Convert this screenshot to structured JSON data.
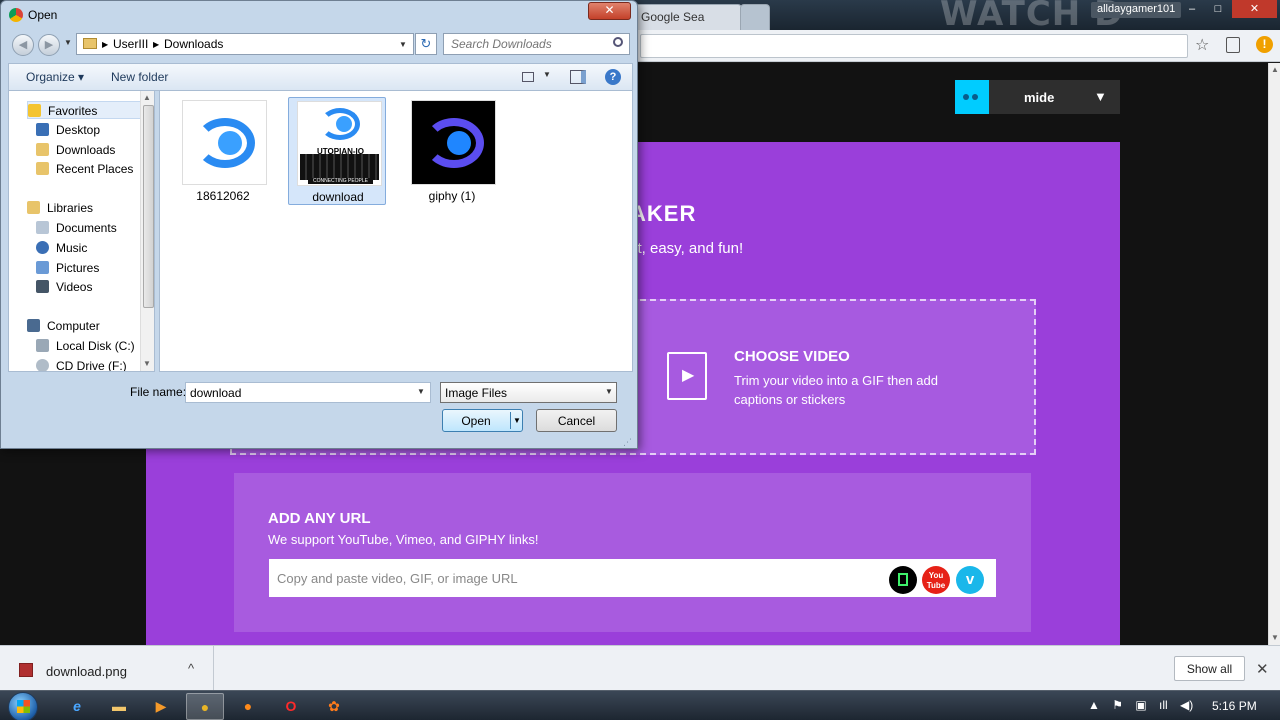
{
  "browser": {
    "tabs": [
      {
        "label": "Google Sea"
      },
      {
        "label": ""
      }
    ],
    "watermark_text": "WATCH D",
    "profile_name": "alldaygamer101",
    "window_controls": {
      "minimize": "–",
      "maximize": "□",
      "close": "✕"
    },
    "toolbar_icons": [
      "star-icon",
      "page-icon",
      "alert-icon"
    ],
    "alert_glyph": "!"
  },
  "site": {
    "user_menu": {
      "name": "mide",
      "caret": "▼"
    },
    "maker_title": "AKER",
    "maker_subtitle": "st, easy, and fun!",
    "choose_video": {
      "title": "CHOOSE VIDEO",
      "description": "Trim your video into a GIF then add captions or stickers",
      "play_glyph": "▶"
    },
    "add_url": {
      "title": "ADD ANY URL",
      "subtitle": "We support YouTube, Vimeo, and GIPHY links!",
      "placeholder": "Copy and paste video, GIF, or image URL",
      "source_icons": [
        "giphy-icon",
        "youtube-icon",
        "vimeo-icon"
      ],
      "youtube_text": "You Tube",
      "vimeo_glyph": "v"
    },
    "colors": {
      "panel": "#9a3fda",
      "accent": "#00ccff"
    }
  },
  "download_bar": {
    "file_name": "download.png",
    "caret": "^",
    "show_all_label": "Show all",
    "close_glyph": "✕"
  },
  "taskbar": {
    "apps": [
      "ie-icon",
      "explorer-icon",
      "media-player-icon",
      "chrome-icon",
      "firefox-icon",
      "opera-icon",
      "app-icon"
    ],
    "app_glyphs": {
      "ie": "e",
      "explorer": "▬",
      "media": "▶",
      "chrome": "●",
      "firefox": "●",
      "opera": "O",
      "app7": "✿"
    },
    "tray_glyphs": [
      "▲",
      "⚑",
      "▣",
      "ıll",
      "◀)"
    ],
    "clock": "5:16 PM"
  },
  "dialog": {
    "title": "Open",
    "close_glyph": "✕",
    "nav": {
      "back": "◀",
      "forward": "▶",
      "recent": "▼",
      "refresh": "↻"
    },
    "address": {
      "segments": [
        "UserIII",
        "Downloads"
      ],
      "separator": "▶",
      "dropdown": "▼"
    },
    "search_placeholder": "Search Downloads",
    "commands": {
      "organize": "Organize ▾",
      "new_folder": "New folder",
      "view_caret": "▼",
      "help": "?"
    },
    "nav_tree": [
      {
        "label": "Favorites",
        "icon": "star-icon",
        "color": "#f4c430"
      },
      {
        "label": "Desktop",
        "icon": "desktop-icon",
        "color": "#3a6fb5"
      },
      {
        "label": "Downloads",
        "icon": "downloads-icon",
        "color": "#e8c46a"
      },
      {
        "label": "Recent Places",
        "icon": "recent-places-icon",
        "color": "#e8c46a"
      },
      {
        "label": "Libraries",
        "icon": "libraries-icon",
        "color": "#e8c46a"
      },
      {
        "label": "Documents",
        "icon": "documents-icon",
        "color": "#b8c6d6"
      },
      {
        "label": "Music",
        "icon": "music-icon",
        "color": "#3a6fb5"
      },
      {
        "label": "Pictures",
        "icon": "pictures-icon",
        "color": "#6a9ad6"
      },
      {
        "label": "Videos",
        "icon": "videos-icon",
        "color": "#445566"
      },
      {
        "label": "Computer",
        "icon": "computer-icon",
        "color": "#4a6a90"
      },
      {
        "label": "Local Disk (C:)",
        "icon": "disk-icon",
        "color": "#9aa8b6"
      },
      {
        "label": "CD Drive (F:)",
        "icon": "cd-drive-icon",
        "color": "#b0bcc8"
      }
    ],
    "files": [
      {
        "name": "18612062",
        "selected": false
      },
      {
        "name": "download",
        "selected": true
      },
      {
        "name": "giphy (1)",
        "selected": false
      }
    ],
    "thumb_text": {
      "utopian": "UTOPIAN-IO",
      "tagline": "CONNECTING PEOPLE"
    },
    "file_name_label": "File name:",
    "file_name_value": "download",
    "file_type": "Image Files",
    "dropdown_glyph": "▼",
    "open_label": "Open",
    "cancel_label": "Cancel",
    "grip_glyph": "⋰"
  }
}
